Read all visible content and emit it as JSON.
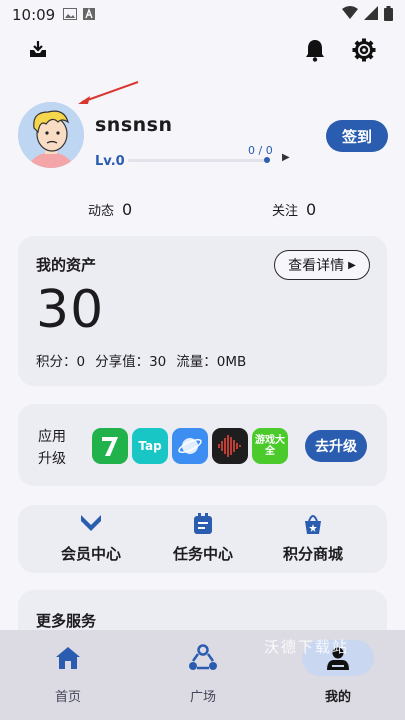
{
  "status_bar": {
    "time": "10:09"
  },
  "profile": {
    "username": "snsnsn",
    "level": "Lv.0",
    "progress_text": "0 / 0",
    "progress_fraction": 0,
    "checkin_label": "签到"
  },
  "stats": [
    {
      "label": "动态",
      "value": "0"
    },
    {
      "label": "关注",
      "value": "0"
    }
  ],
  "assets": {
    "title": "我的资产",
    "detail_label": "查看详情",
    "amount": "30",
    "points": "积分：0",
    "share": "分享值：30",
    "traffic": "流量：0MB"
  },
  "upgrade": {
    "label": "应用升级",
    "button": "去升级",
    "apps": [
      {
        "icon": "app-7-icon",
        "text": "7",
        "color": "#22B24C"
      },
      {
        "icon": "taptap-icon",
        "text": "Tap",
        "color": "#18C6C6"
      },
      {
        "icon": "planet-icon",
        "text": "",
        "color": "#3D8EF2"
      },
      {
        "icon": "sound-wave-icon",
        "text": "",
        "color": "#1e1e1e"
      },
      {
        "icon": "game-store-icon",
        "text": "游戏大全",
        "color": "#4BCB2B"
      }
    ]
  },
  "quick": [
    {
      "icon": "vip-icon",
      "label": "会员中心"
    },
    {
      "icon": "task-icon",
      "label": "任务中心"
    },
    {
      "icon": "shop-icon",
      "label": "积分商城"
    }
  ],
  "more": {
    "title": "更多服务"
  },
  "tabs": [
    {
      "icon": "home-icon",
      "label": "首页"
    },
    {
      "icon": "square-icon",
      "label": "广场"
    },
    {
      "icon": "mine-icon",
      "label": "我的"
    }
  ],
  "watermark": "沃德下载站",
  "colors": {
    "accent": "#2A5DB0",
    "background": "#F6F5FA",
    "card": "#ECECF3"
  }
}
